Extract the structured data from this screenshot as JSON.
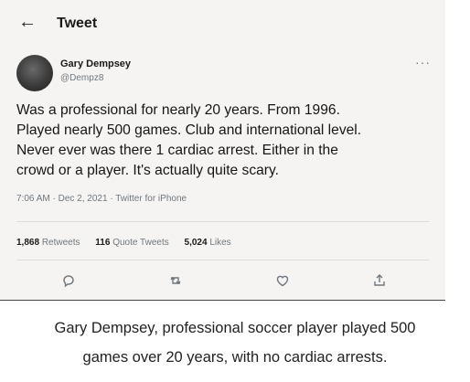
{
  "header": {
    "back_icon": "left-arrow-icon",
    "title": "Tweet"
  },
  "tweet": {
    "author_name": "Gary Dempsey",
    "author_handle": "@Dempz8",
    "more_icon": "more-dots-icon",
    "text": "Was a professional for nearly 20 years. From 1996.\nPlayed nearly 500 games. Club and international level.\nNever ever was there 1 cardiac arrest. Either in the\ncrowd or a player. It's actually quite scary.",
    "time": "7:06 AM",
    "date": "Dec 2, 2021",
    "source": "Twitter for iPhone",
    "retweets_count": "1,868",
    "retweets_label": "Retweets",
    "quote_count": "116",
    "quote_label": "Quote Tweets",
    "likes_count": "5,024",
    "likes_label": "Likes"
  },
  "actions": [
    "reply-icon",
    "retweet-icon",
    "like-icon",
    "share-icon"
  ],
  "caption": {
    "line1": "Gary Dempsey, professional soccer player played 500",
    "line2": "games over 20 years, with no cardiac arrests."
  }
}
